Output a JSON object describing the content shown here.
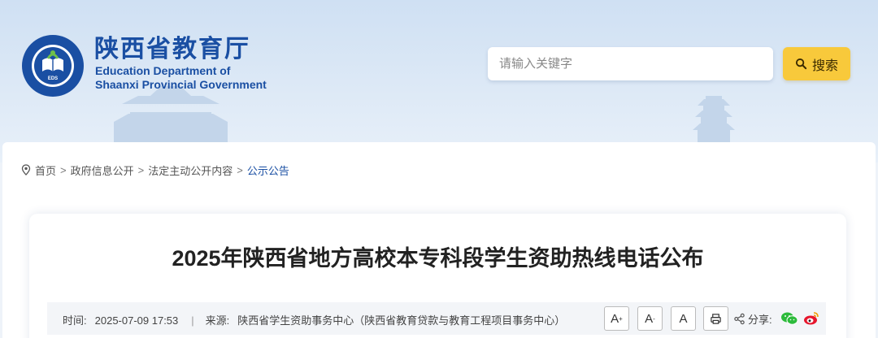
{
  "header": {
    "logo_text_top": "EDUCATION DEPARTMENT OF SHAANXI",
    "logo_text_bottom": "陕西省教育厅",
    "logo_badge": "EDS",
    "brand_cn": "陕西省教育厅",
    "brand_en_line1": "Education Department of",
    "brand_en_line2": "Shaanxi Provincial Government",
    "search_placeholder": "请输入关键字",
    "search_label": "搜索"
  },
  "breadcrumb": {
    "items": [
      "首页",
      "政府信息公开",
      "法定主动公开内容",
      "公示公告"
    ],
    "separator": ">"
  },
  "article": {
    "title": "2025年陕西省地方高校本专科段学生资助热线电话公布",
    "time_label": "时间:",
    "time_value": "2025-07-09 17:53",
    "divider": "|",
    "source_label": "来源:",
    "source_value": "陕西省学生资助事务中心（陕西省教育贷款与教育工程项目事务中心）",
    "font_large": "A",
    "font_medium": "A",
    "font_small": "A",
    "share_label": "分享:"
  },
  "icons": [
    "search-icon",
    "location-pin-icon",
    "print-icon",
    "share-icon",
    "wechat-icon",
    "weibo-icon"
  ],
  "colors": {
    "brand_blue": "#1a4fa3",
    "search_button": "#f8c93b",
    "meta_bar": "#f3f5f8"
  }
}
